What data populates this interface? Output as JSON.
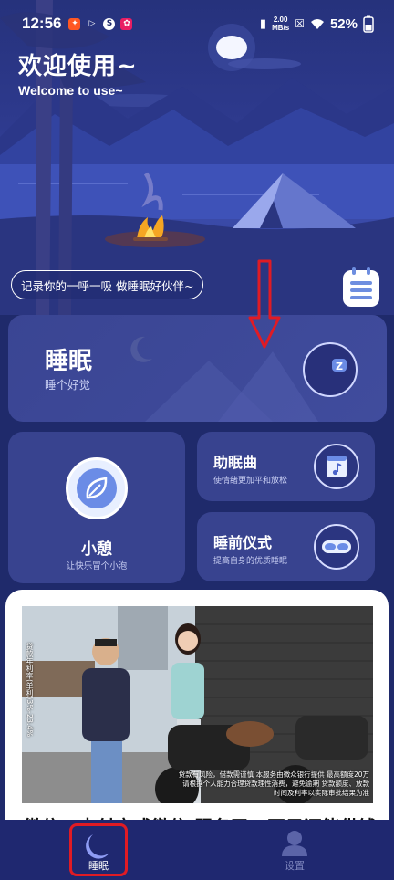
{
  "status_bar": {
    "time": "12:56",
    "net_speed_value": "2.00",
    "net_speed_unit": "MB/s",
    "battery": "52%",
    "app_icons": [
      "app-red-icon",
      "app-play-icon",
      "app-s-icon",
      "app-pink-icon"
    ]
  },
  "hero": {
    "title": "欢迎使用~",
    "subtitle": "Welcome to use~",
    "tagline": "记录你的一呼一吸  做睡眠好伙伴~"
  },
  "cards": {
    "sleep": {
      "title": "睡眠",
      "subtitle": "睡个好觉"
    },
    "nap": {
      "title": "小憩",
      "subtitle": "让快乐冒个小泡"
    },
    "music": {
      "title": "助眠曲",
      "subtitle": "使情绪更加平和放松"
    },
    "ritual": {
      "title": "睡前仪式",
      "subtitle": "提高自身的优质睡眠"
    }
  },
  "ad": {
    "caption": "微信、支付宝或微信 服务了，再只还能借钱了",
    "side_text": "贷款年利率(单利)3%-23.4%",
    "disclaimer": "贷款有风险，借款需谨慎 本服务由微众银行提供 最高额度20万 请根据个人能力合理贷款理性消费，避免逾期 贷款额度、放款时间及利率以实际审批结果为准"
  },
  "nav": {
    "sleep_label": "睡眠",
    "settings_label": "设置"
  },
  "colors": {
    "background": "#1f2a6b",
    "card": "#38438f",
    "annotation_red": "#e01b24",
    "accent_blue": "#6b8ce6"
  }
}
